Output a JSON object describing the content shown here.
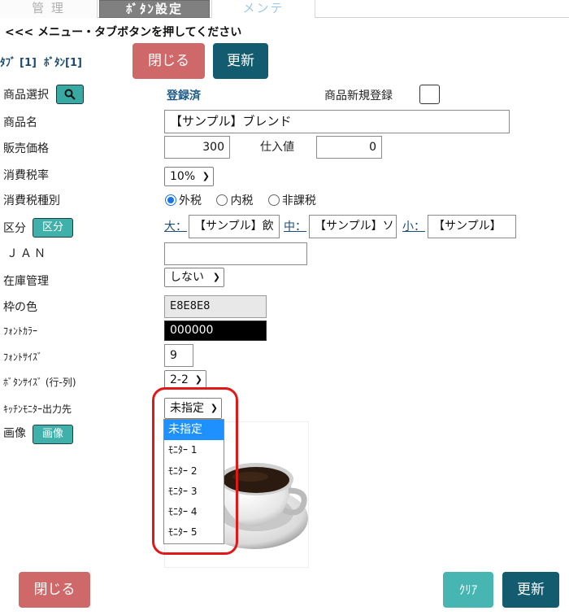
{
  "tabs": [
    "管 理",
    "ﾎﾞﾀﾝ設定",
    "メンテ"
  ],
  "instruction": "<<< メニュー・タブボタンを押してください",
  "counts": {
    "tab": "ﾀﾌﾞ [1]",
    "button": "ﾎﾞﾀﾝ[1]"
  },
  "toolbar": {
    "close_label": "閉じる",
    "update_label": "更新"
  },
  "product_select": {
    "label": "商品選択",
    "status": "登録済",
    "new_register_label": "商品新規登録"
  },
  "product_name": {
    "label": "商品名",
    "value": "【サンプル】ブレンド"
  },
  "price": {
    "label": "販売価格",
    "value": "300",
    "cost_label": "仕入値",
    "cost_value": "0"
  },
  "tax_rate": {
    "label": "消費税率",
    "value": "10%"
  },
  "tax_type": {
    "label": "消費税種別",
    "options": [
      "外税",
      "内税",
      "非課税"
    ],
    "selected": "外税"
  },
  "category": {
    "label": "区分",
    "button": "区分",
    "large_label": "大：",
    "large_value": "【サンプル】飲",
    "medium_label": "中：",
    "medium_value": "【サンプル】ソ",
    "small_label": "小：",
    "small_value": "【サンプル】"
  },
  "jan": {
    "label": "ＪＡＮ",
    "value": ""
  },
  "stock": {
    "label": "在庫管理",
    "value": "しない"
  },
  "frame_color": {
    "label": "枠の色",
    "value": "E8E8E8",
    "color": "#E8E8E8"
  },
  "font_color": {
    "label": "ﾌｫﾝﾄｶﾗｰ",
    "value": "000000",
    "color": "#000000"
  },
  "font_size": {
    "label": "ﾌｫﾝﾄｻｲｽﾞ",
    "value": "9"
  },
  "button_size": {
    "label": "ﾎﾞﾀﾝｻｲｽﾞ (行-列)",
    "value": "2-2"
  },
  "kitchen_monitor": {
    "label": "ｷｯﾁﾝﾓﾆﾀｰ出力先",
    "value": "未指定",
    "options": [
      "未指定",
      "ﾓﾆﾀｰ 1",
      "ﾓﾆﾀｰ 2",
      "ﾓﾆﾀｰ 3",
      "ﾓﾆﾀｰ 4",
      "ﾓﾆﾀｰ 5"
    ]
  },
  "image": {
    "label": "画像",
    "button": "画像"
  },
  "footer": {
    "close_label": "閉じる",
    "clear_label": "ｸﾘｱ",
    "update_label": "更新"
  },
  "colors": {
    "red": "#cf6868",
    "navy": "#135c70",
    "teal": "#47b5b1",
    "highlight": "#e01818",
    "selection": "#1e90ff"
  }
}
